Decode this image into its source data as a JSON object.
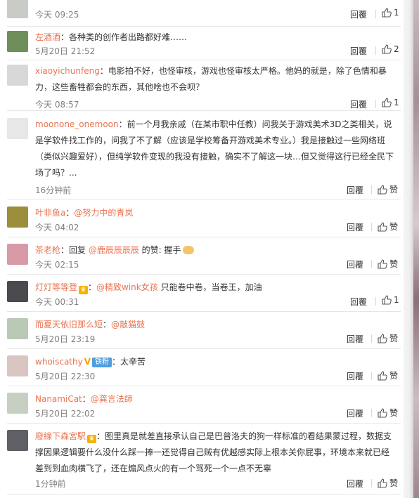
{
  "reply_label": "回覆",
  "comments": [
    {
      "username": "",
      "text": "",
      "time": "今天 09:25",
      "like_count": "1",
      "avatar_color": "#c9cbc7"
    },
    {
      "username": "左酒酒",
      "text": "：各种类的创作者出路都好难……",
      "time": "5月20日 21:52",
      "like_count": "2",
      "avatar_color": "#6f8f5a"
    },
    {
      "username": "xiaoyichunfeng",
      "text": "：电影拍不好，也怪审核，游戏也怪审核太严格。他妈的就是，除了色情和暴力，这些畜牲都会的东西，其他啥也不会呗？",
      "time": "今天 08:57",
      "like_count": "1",
      "avatar_color": "#d8d8d8"
    },
    {
      "username": "moonone_onemoon",
      "text": "：前一个月我亲戚（在某市职中任教）问我关于游戏美术3D之类相关，说是学软件找工作的，问我了不了解（应该是学校筹备开游戏美术专业。）我是接触过一些网络班（类似兴趣爱好），但纯学软件变现的我没有接触，确实不了解这一块…但又觉得这行已经全民下场了吗？...",
      "time": "16分钟前",
      "like_count": "赞",
      "avatar_color": "#e7e7e7"
    },
    {
      "username": "叶非鱼a",
      "text": "：",
      "mention": "@努力中的青岚",
      "time": "今天 04:02",
      "like_count": "赞",
      "avatar_color": "#9b8e3c"
    },
    {
      "username": "茶老枪",
      "text": "：回复 ",
      "mention": "@鹿辰辰辰辰",
      "text_after": " 的赞: 握手",
      "time": "今天 02:15",
      "like_count": "赞",
      "avatar_color": "#d99aa7"
    },
    {
      "username": "灯灯等等登",
      "text": "：",
      "mention": "@精致wink女孩",
      "text_after": " 只能卷中卷，当卷王，加油",
      "time": "今天 00:31",
      "like_count": "1",
      "avatar_color": "#4b4a4f"
    },
    {
      "username": "而夏天依旧那么短",
      "text": "：",
      "mention": "@敲猫鼓",
      "time": "5月20日 23:19",
      "like_count": "赞",
      "avatar_color": "#b9c9b5"
    },
    {
      "username": "whoiscathy",
      "text": "：太辛苦",
      "fans_badge": "铁粉",
      "time": "5月20日 22:30",
      "like_count": "赞",
      "avatar_color": "#d9c6c3"
    },
    {
      "username": "NanamiCat",
      "text": "：",
      "mention": "@龚言法師",
      "time": "5月20日 22:02",
      "like_count": "赞",
      "avatar_color": "#c7cfc2"
    },
    {
      "username": "廢線下森宮駅",
      "text": "：图里真是就差直接承认自己是巴普洛夫的狗一样标准的看结果蒙过程，数据支撑因果逻辑要什么没什么踩一捧一还觉得自己贼有优越感实际上根本关你屁事，环境本来就已经差到到血肉横飞了，还在煽风点火的有一个骂死一个一点不无辜",
      "time": "1分钟前",
      "like_count": "赞",
      "avatar_color": "#5f5f66"
    }
  ]
}
